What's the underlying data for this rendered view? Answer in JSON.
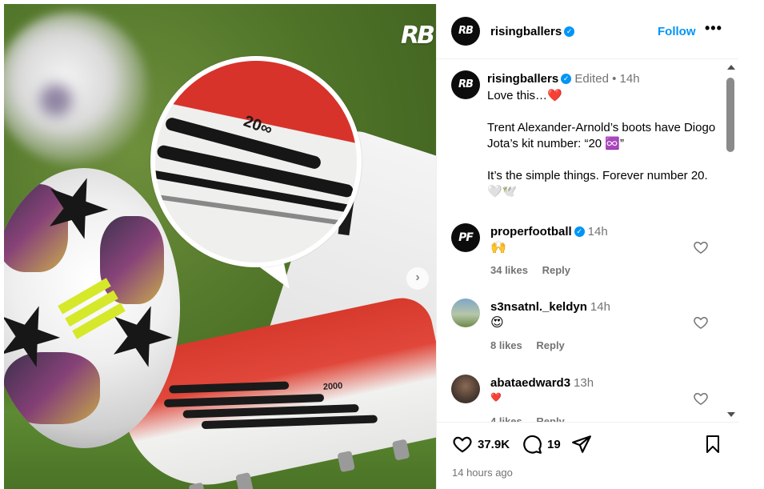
{
  "media": {
    "brand_mark": "RB",
    "zoom_number": "20∞",
    "boot_number": "2000",
    "next_icon": "chevron-right-icon"
  },
  "header": {
    "avatar_text": "RB",
    "username": "risingballers",
    "follow_label": "Follow",
    "more_label": "•••"
  },
  "caption": {
    "avatar_text": "RB",
    "username": "risingballers",
    "edited": "Edited",
    "separator": "•",
    "time": "14h",
    "lines": [
      "Love this…❤️",
      "Trent Alexander-Arnold’s boots have Diogo Jota’s kit number: “20 ♾️”",
      "It’s the simple things. Forever number 20. 🤍🕊️"
    ]
  },
  "comments": [
    {
      "avatar_text": "PF",
      "username": "properfootball",
      "verified": true,
      "time": "14h",
      "body": "🙌",
      "likes": "34 likes",
      "reply": "Reply"
    },
    {
      "avatar_text": "",
      "username": "s3nsatnl._keldyn",
      "verified": false,
      "time": "14h",
      "body": "😍",
      "likes": "8 likes",
      "reply": "Reply"
    },
    {
      "avatar_text": "",
      "username": "abataedward3",
      "verified": false,
      "time": "13h",
      "body": "❤️",
      "likes": "4 likes",
      "reply": "Reply"
    }
  ],
  "actions": {
    "likes_count": "37.9K",
    "comments_count": "19",
    "time_ago": "14 hours ago"
  },
  "colors": {
    "accent": "#0095f6",
    "muted": "#737373",
    "border": "#efefef"
  }
}
